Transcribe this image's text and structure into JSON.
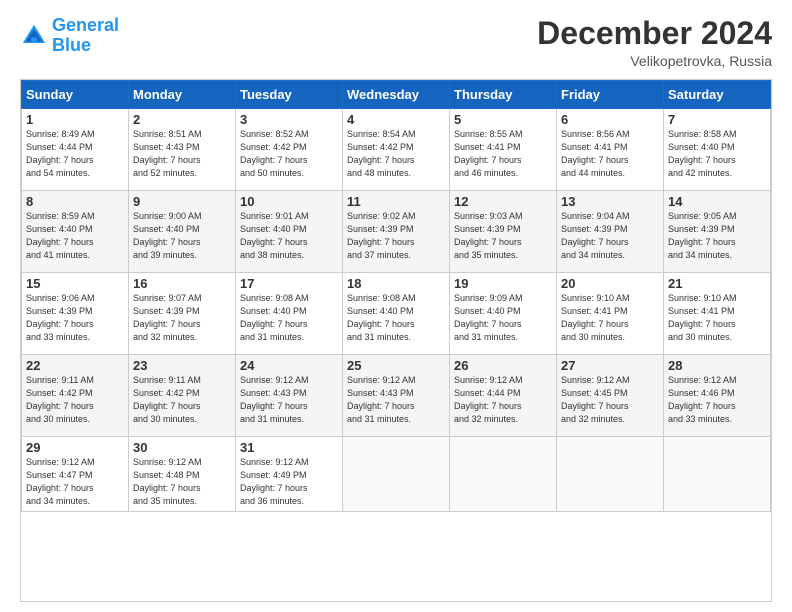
{
  "logo": {
    "line1": "General",
    "line2": "Blue"
  },
  "title": "December 2024",
  "subtitle": "Velikopetrovka, Russia",
  "headers": [
    "Sunday",
    "Monday",
    "Tuesday",
    "Wednesday",
    "Thursday",
    "Friday",
    "Saturday"
  ],
  "weeks": [
    [
      {
        "day": "1",
        "sunrise": "8:49 AM",
        "sunset": "4:44 PM",
        "daylight": "7 hours and 54 minutes."
      },
      {
        "day": "2",
        "sunrise": "8:51 AM",
        "sunset": "4:43 PM",
        "daylight": "7 hours and 52 minutes."
      },
      {
        "day": "3",
        "sunrise": "8:52 AM",
        "sunset": "4:42 PM",
        "daylight": "7 hours and 50 minutes."
      },
      {
        "day": "4",
        "sunrise": "8:54 AM",
        "sunset": "4:42 PM",
        "daylight": "7 hours and 48 minutes."
      },
      {
        "day": "5",
        "sunrise": "8:55 AM",
        "sunset": "4:41 PM",
        "daylight": "7 hours and 46 minutes."
      },
      {
        "day": "6",
        "sunrise": "8:56 AM",
        "sunset": "4:41 PM",
        "daylight": "7 hours and 44 minutes."
      },
      {
        "day": "7",
        "sunrise": "8:58 AM",
        "sunset": "4:40 PM",
        "daylight": "7 hours and 42 minutes."
      }
    ],
    [
      {
        "day": "8",
        "sunrise": "8:59 AM",
        "sunset": "4:40 PM",
        "daylight": "7 hours and 41 minutes."
      },
      {
        "day": "9",
        "sunrise": "9:00 AM",
        "sunset": "4:40 PM",
        "daylight": "7 hours and 39 minutes."
      },
      {
        "day": "10",
        "sunrise": "9:01 AM",
        "sunset": "4:40 PM",
        "daylight": "7 hours and 38 minutes."
      },
      {
        "day": "11",
        "sunrise": "9:02 AM",
        "sunset": "4:39 PM",
        "daylight": "7 hours and 37 minutes."
      },
      {
        "day": "12",
        "sunrise": "9:03 AM",
        "sunset": "4:39 PM",
        "daylight": "7 hours and 35 minutes."
      },
      {
        "day": "13",
        "sunrise": "9:04 AM",
        "sunset": "4:39 PM",
        "daylight": "7 hours and 34 minutes."
      },
      {
        "day": "14",
        "sunrise": "9:05 AM",
        "sunset": "4:39 PM",
        "daylight": "7 hours and 34 minutes."
      }
    ],
    [
      {
        "day": "15",
        "sunrise": "9:06 AM",
        "sunset": "4:39 PM",
        "daylight": "7 hours and 33 minutes."
      },
      {
        "day": "16",
        "sunrise": "9:07 AM",
        "sunset": "4:39 PM",
        "daylight": "7 hours and 32 minutes."
      },
      {
        "day": "17",
        "sunrise": "9:08 AM",
        "sunset": "4:40 PM",
        "daylight": "7 hours and 31 minutes."
      },
      {
        "day": "18",
        "sunrise": "9:08 AM",
        "sunset": "4:40 PM",
        "daylight": "7 hours and 31 minutes."
      },
      {
        "day": "19",
        "sunrise": "9:09 AM",
        "sunset": "4:40 PM",
        "daylight": "7 hours and 31 minutes."
      },
      {
        "day": "20",
        "sunrise": "9:10 AM",
        "sunset": "4:41 PM",
        "daylight": "7 hours and 30 minutes."
      },
      {
        "day": "21",
        "sunrise": "9:10 AM",
        "sunset": "4:41 PM",
        "daylight": "7 hours and 30 minutes."
      }
    ],
    [
      {
        "day": "22",
        "sunrise": "9:11 AM",
        "sunset": "4:42 PM",
        "daylight": "7 hours and 30 minutes."
      },
      {
        "day": "23",
        "sunrise": "9:11 AM",
        "sunset": "4:42 PM",
        "daylight": "7 hours and 30 minutes."
      },
      {
        "day": "24",
        "sunrise": "9:12 AM",
        "sunset": "4:43 PM",
        "daylight": "7 hours and 31 minutes."
      },
      {
        "day": "25",
        "sunrise": "9:12 AM",
        "sunset": "4:43 PM",
        "daylight": "7 hours and 31 minutes."
      },
      {
        "day": "26",
        "sunrise": "9:12 AM",
        "sunset": "4:44 PM",
        "daylight": "7 hours and 32 minutes."
      },
      {
        "day": "27",
        "sunrise": "9:12 AM",
        "sunset": "4:45 PM",
        "daylight": "7 hours and 32 minutes."
      },
      {
        "day": "28",
        "sunrise": "9:12 AM",
        "sunset": "4:46 PM",
        "daylight": "7 hours and 33 minutes."
      }
    ],
    [
      {
        "day": "29",
        "sunrise": "9:12 AM",
        "sunset": "4:47 PM",
        "daylight": "7 hours and 34 minutes."
      },
      {
        "day": "30",
        "sunrise": "9:12 AM",
        "sunset": "4:48 PM",
        "daylight": "7 hours and 35 minutes."
      },
      {
        "day": "31",
        "sunrise": "9:12 AM",
        "sunset": "4:49 PM",
        "daylight": "7 hours and 36 minutes."
      },
      null,
      null,
      null,
      null
    ]
  ]
}
